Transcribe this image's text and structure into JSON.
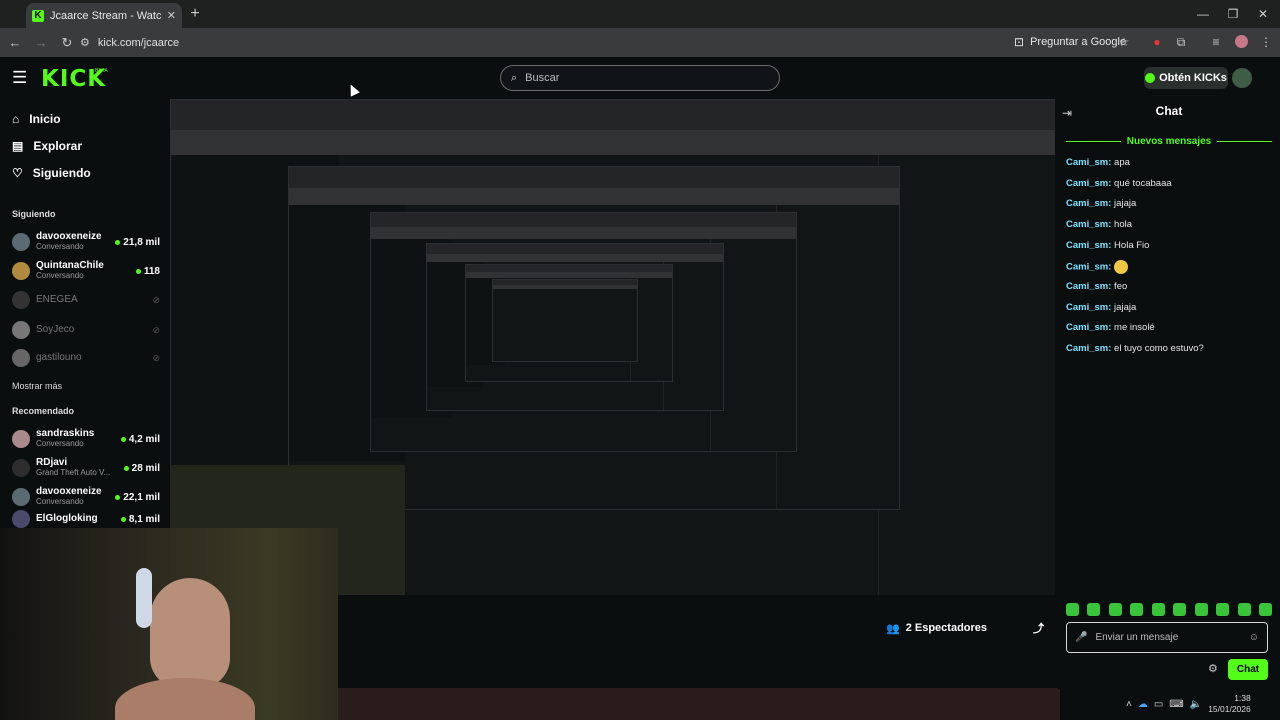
{
  "browser": {
    "tab_title": "Jcaarce Stream - Watch Live on",
    "tab_close": "✕",
    "new_tab": "+",
    "url": "kick.com/jcaarce",
    "google_chip": "Preguntar a Google"
  },
  "header": {
    "logo": "KICK",
    "beta": "BETA",
    "search_placeholder": "Buscar",
    "kicks_button": "Obtén KICKs"
  },
  "sidebar": {
    "nav": [
      {
        "label": "Inicio",
        "icon": "home-icon"
      },
      {
        "label": "Explorar",
        "icon": "explore-icon"
      },
      {
        "label": "Siguiendo",
        "icon": "heart-icon"
      }
    ],
    "following_heading": "Siguiendo",
    "following": [
      {
        "name": "davooxeneize",
        "category": "Conversando",
        "viewers": "21,8 mil",
        "live": true
      },
      {
        "name": "QuintanaChile",
        "category": "Conversando",
        "viewers": "118",
        "live": true
      },
      {
        "name": "ENEGEA",
        "category": "",
        "viewers": "",
        "live": false
      },
      {
        "name": "SoyJeco",
        "category": "",
        "viewers": "",
        "live": false
      },
      {
        "name": "gastilouno",
        "category": "",
        "viewers": "",
        "live": false
      }
    ],
    "show_more": "Mostrar más",
    "recommended_heading": "Recomendado",
    "recommended": [
      {
        "name": "sandraskins",
        "category": "Conversando",
        "viewers": "4,2 mil"
      },
      {
        "name": "RDjavi",
        "category": "Grand Theft Auto V...",
        "viewers": "28 mil"
      },
      {
        "name": "davooxeneize",
        "category": "Conversando",
        "viewers": "22,1 mil"
      },
      {
        "name": "ElGlogloking",
        "category": "",
        "viewers": "8,1 mil"
      }
    ]
  },
  "stream": {
    "viewers_label": "2 Espectadores"
  },
  "chat": {
    "title": "Chat",
    "new_messages": "Nuevos mensajes",
    "messages": [
      {
        "user": "Cami_sm:",
        "text": " apa"
      },
      {
        "user": "Cami_sm:",
        "text": " qué tocabaaa"
      },
      {
        "user": "Cami_sm:",
        "text": " jajaja"
      },
      {
        "user": "Cami_sm:",
        "text": " hola"
      },
      {
        "user": "Cami_sm:",
        "text": " Hola Fio"
      },
      {
        "user": "Cami_sm:",
        "text": ""
      },
      {
        "user": "Cami_sm:",
        "text": " feo"
      },
      {
        "user": "Cami_sm:",
        "text": " jajaja"
      },
      {
        "user": "Cami_sm:",
        "text": " me insolé"
      },
      {
        "user": "Cami_sm:",
        "text": " el tuyo como estuvo?"
      }
    ],
    "input_placeholder": "Enviar un mensaje",
    "send_button": "Chat"
  },
  "taskbar": {
    "time": "1:38",
    "date": "15/01/2026"
  },
  "colors": {
    "accent": "#53fc18",
    "username": "#7ee0ff"
  }
}
